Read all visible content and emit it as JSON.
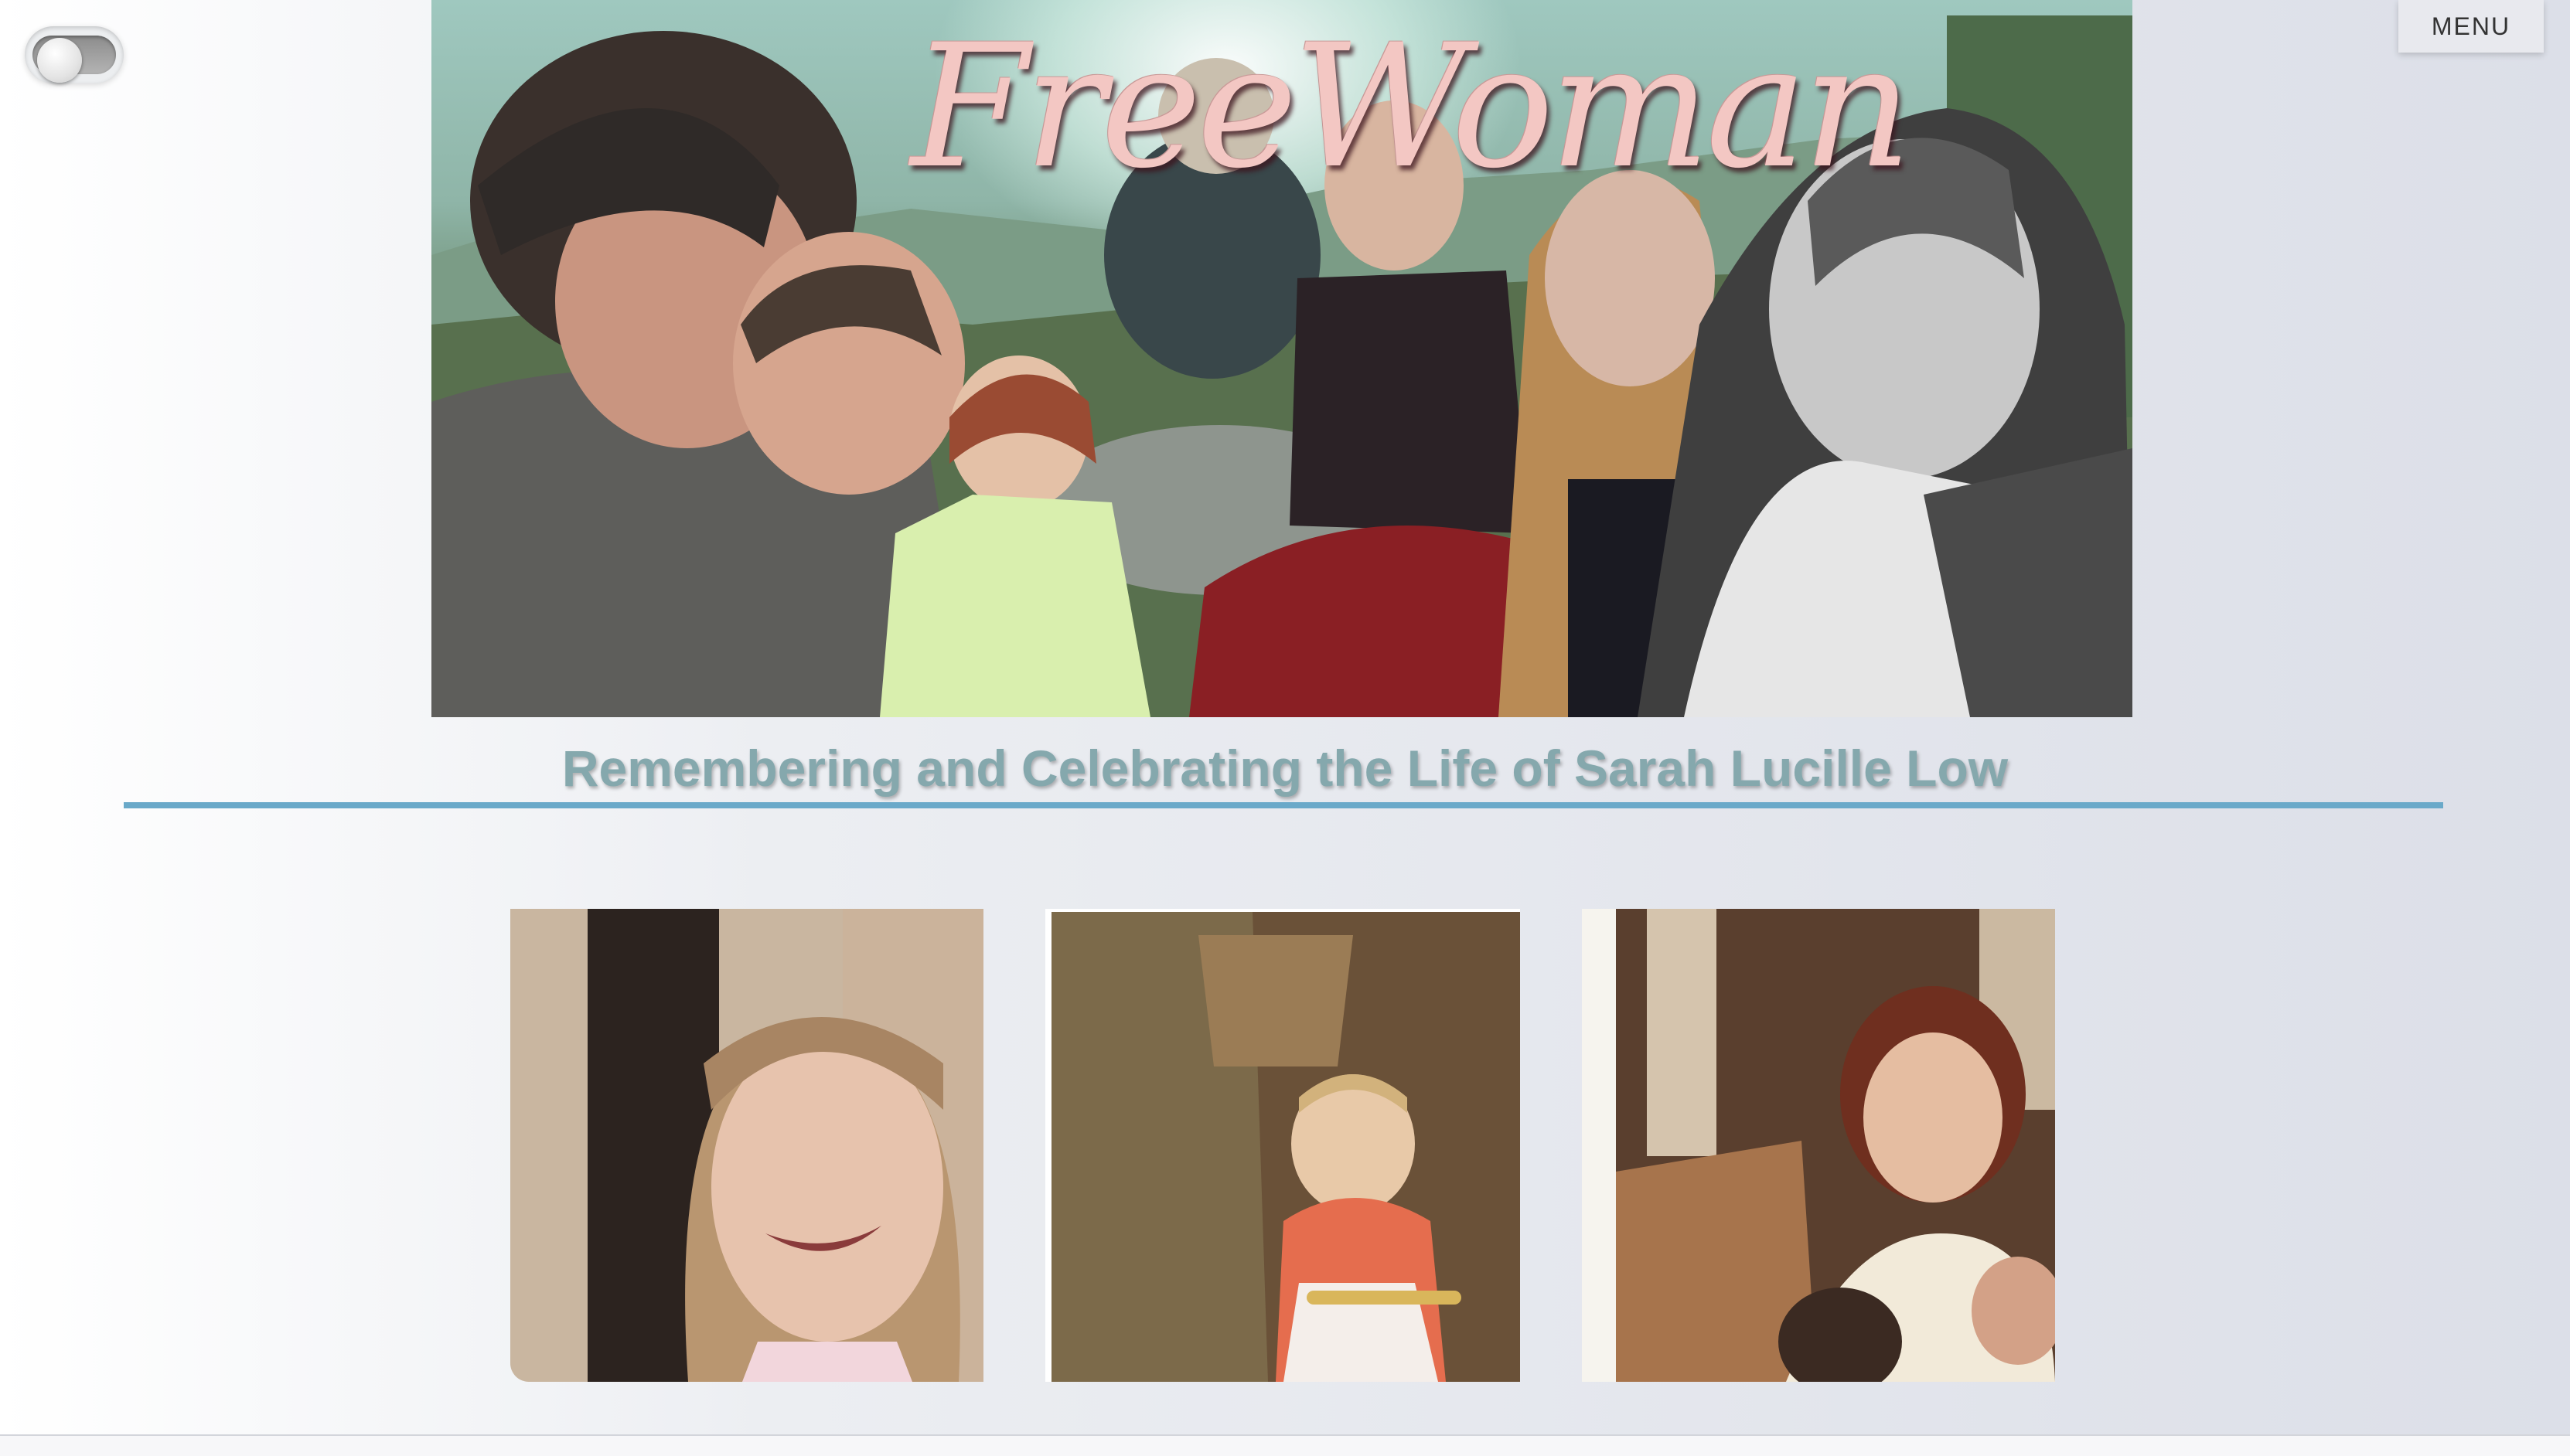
{
  "theme_toggle": {
    "state": "off"
  },
  "menu": {
    "label": "MENU"
  },
  "banner": {
    "title": "FreeWoman"
  },
  "tagline": "Remembering and Celebrating the Life of Sarah Lucille Low",
  "gallery": {
    "photos": [
      {
        "subject": "smiling girl with bangs"
      },
      {
        "subject": "toddler sitting on floor"
      },
      {
        "subject": "woman with two children"
      }
    ]
  },
  "colors": {
    "accent_rule": "#6aa9c9",
    "tagline": "#85a8ad",
    "title": "#f3c7c3"
  },
  "icons": [
    "toggle-switch-icon"
  ]
}
